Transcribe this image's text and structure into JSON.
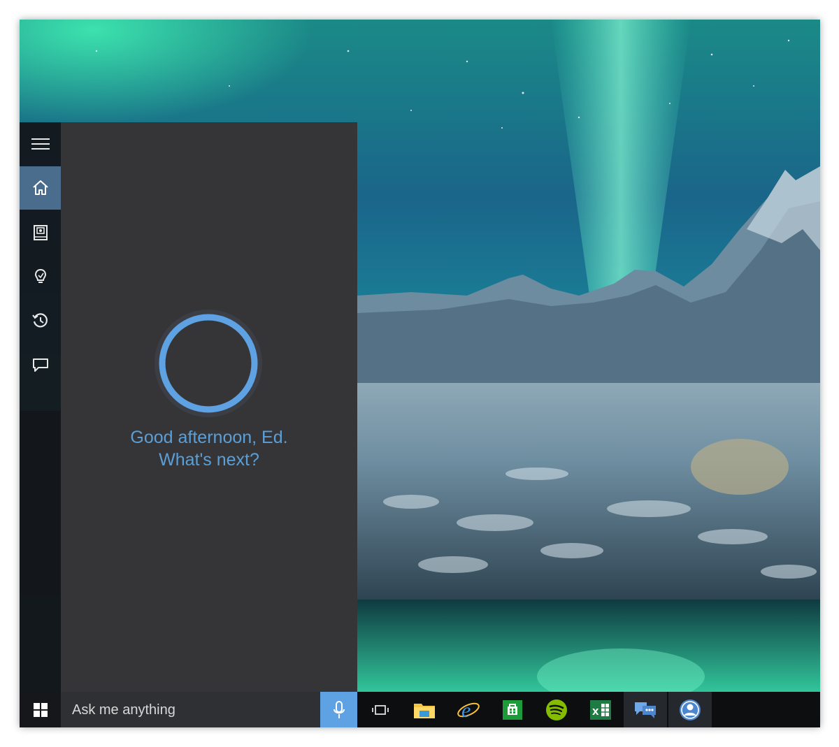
{
  "cortana": {
    "greeting_line1": "Good afternoon, Ed.",
    "greeting_line2": "What's next?"
  },
  "sidebar": {
    "items": [
      {
        "icon": "hamburger-menu-icon"
      },
      {
        "icon": "home-icon",
        "active": true
      },
      {
        "icon": "notebook-icon"
      },
      {
        "icon": "lightbulb-icon"
      },
      {
        "icon": "reminders-clock-icon"
      },
      {
        "icon": "feedback-icon"
      }
    ]
  },
  "taskbar": {
    "search_placeholder": "Ask me anything",
    "apps": [
      {
        "icon": "task-view-icon"
      },
      {
        "icon": "file-explorer-icon"
      },
      {
        "icon": "internet-explorer-icon"
      },
      {
        "icon": "store-icon"
      },
      {
        "icon": "spotify-icon"
      },
      {
        "icon": "excel-icon"
      },
      {
        "icon": "chat-bubbles-icon"
      },
      {
        "icon": "account-icon"
      }
    ]
  },
  "colors": {
    "accent": "#5ea2e3",
    "greeting": "#5a9fd7",
    "panel": "#353537",
    "active_rail": "#4a6d8e"
  }
}
